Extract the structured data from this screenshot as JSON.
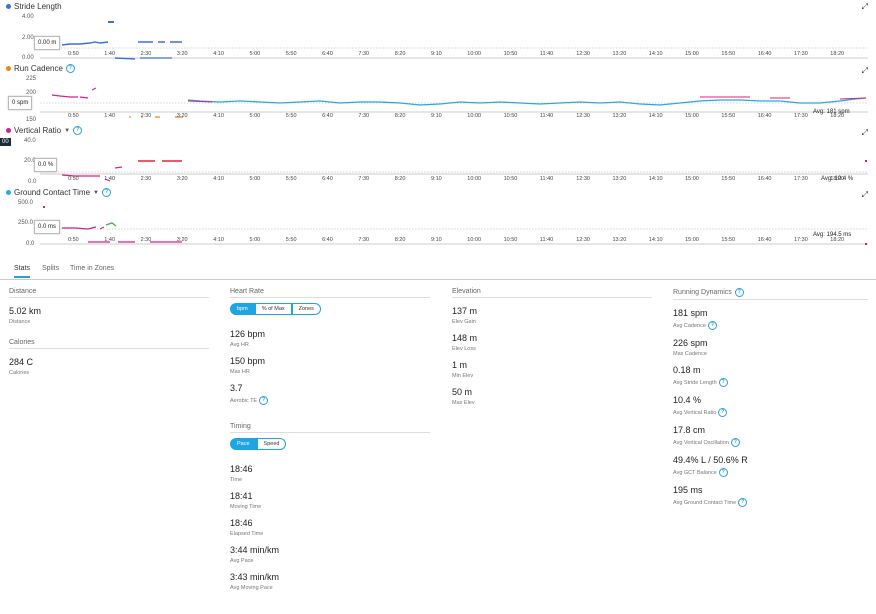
{
  "charts": [
    {
      "id": "stride",
      "title": "Stride Length",
      "dot_color": "#3d6fd6",
      "has_help": false,
      "has_caret": false,
      "y_ticks": [
        "4.00",
        "2.00",
        "0.00"
      ],
      "tooltip": "0.00 m",
      "avg": ""
    },
    {
      "id": "cadence",
      "title": "Run Cadence",
      "dot_color": "#e8881a",
      "has_help": true,
      "has_caret": false,
      "y_ticks": [
        "225",
        "200",
        "150"
      ],
      "tooltip": "0 spm",
      "avg": "Avg: 181 spm"
    },
    {
      "id": "vratio",
      "title": "Vertical Ratio",
      "dot_color": "#d4218a",
      "has_help": true,
      "has_caret": true,
      "y_ticks": [
        "40.0",
        "20.0",
        "0.0"
      ],
      "tooltip": "0.0 %",
      "avg": "Avg: 10.4 %",
      "left_tag": "00"
    },
    {
      "id": "gct",
      "title": "Ground Contact Time",
      "dot_color": "#2ba8e0",
      "has_help": true,
      "has_caret": true,
      "y_ticks": [
        "500.0",
        "250.0",
        "0.0"
      ],
      "tooltip": "0.0 ms",
      "avg": "Avg: 194.5 ms"
    }
  ],
  "x_ticks": [
    "0:50",
    "1:40",
    "2:30",
    "3:20",
    "4:10",
    "5:00",
    "5:50",
    "6:40",
    "7:30",
    "8:20",
    "9:10",
    "10:00",
    "10:50",
    "11:40",
    "12:30",
    "13:20",
    "14:10",
    "15:00",
    "15:50",
    "16:40",
    "17:30",
    "18:20"
  ],
  "tabs": [
    {
      "label": "Stats",
      "active": true
    },
    {
      "label": "Splits",
      "active": false
    },
    {
      "label": "Time in Zones",
      "active": false
    }
  ],
  "stats": {
    "distance": {
      "header": "Distance",
      "value": "5.02 km",
      "label": "Distance"
    },
    "calories": {
      "header": "Calories",
      "value": "284 C",
      "label": "Calories"
    },
    "heart_rate": {
      "header": "Heart Rate",
      "toggle": [
        "bpm",
        "% of Max",
        "Zones"
      ],
      "items": [
        {
          "value": "126 bpm",
          "label": "Avg HR",
          "help": false
        },
        {
          "value": "150 bpm",
          "label": "Max HR",
          "help": false
        },
        {
          "value": "3.7",
          "label": "Aerobic TE",
          "help": true
        }
      ]
    },
    "timing": {
      "header": "Timing",
      "toggle": [
        "Pace",
        "Speed"
      ],
      "items": [
        {
          "value": "18:46",
          "label": "Time"
        },
        {
          "value": "18:41",
          "label": "Moving Time"
        },
        {
          "value": "18:46",
          "label": "Elapsed Time"
        },
        {
          "value": "3:44 min/km",
          "label": "Avg Pace"
        },
        {
          "value": "3:43 min/km",
          "label": "Avg Moving Pace"
        }
      ]
    },
    "elevation": {
      "header": "Elevation",
      "items": [
        {
          "value": "137 m",
          "label": "Elev Gain"
        },
        {
          "value": "148 m",
          "label": "Elev Loss"
        },
        {
          "value": "1 m",
          "label": "Min Elev"
        },
        {
          "value": "50 m",
          "label": "Max Elev"
        }
      ]
    },
    "running_dynamics": {
      "header": "Running Dynamics",
      "items": [
        {
          "value": "181 spm",
          "label": "Avg Cadence",
          "help": true
        },
        {
          "value": "226 spm",
          "label": "Max Cadence",
          "help": false
        },
        {
          "value": "0.18 m",
          "label": "Avg Stride Length",
          "help": true
        },
        {
          "value": "10.4 %",
          "label": "Avg Vertical Ratio",
          "help": true
        },
        {
          "value": "17.8 cm",
          "label": "Avg Vertical Oscillation",
          "help": true
        },
        {
          "value": "49.4% L / 50.6% R",
          "label": "Avg GCT Balance",
          "help": true
        },
        {
          "value": "195 ms",
          "label": "Avg Ground Contact Time",
          "help": true
        }
      ]
    }
  },
  "colors": {
    "accent": "#1fa5e0",
    "cadence_line": "#2ba8e0",
    "magenta": "#d4218a",
    "red": "#e8203a",
    "blue": "#3d6fd6",
    "orange": "#e8881a",
    "green": "#3cb043"
  }
}
